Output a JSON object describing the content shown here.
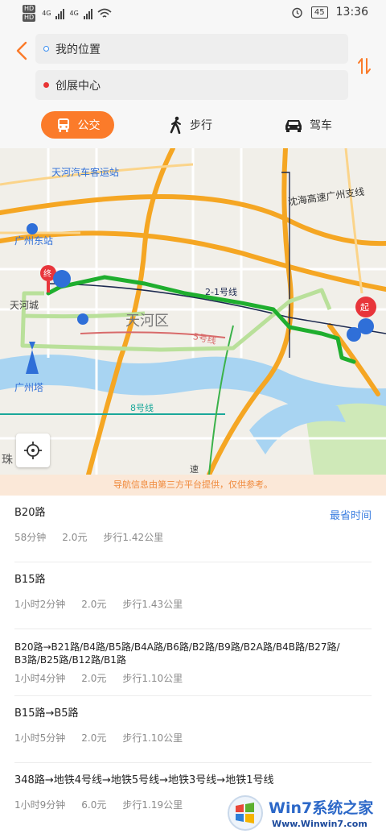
{
  "status_bar": {
    "hd1": "HD",
    "hd2": "HD",
    "net1": "4G",
    "net2": "4G",
    "battery": "45",
    "time": "13:36"
  },
  "header": {
    "origin": "我的位置",
    "destination": "创展中心",
    "modes": [
      {
        "label": "公交",
        "icon": "bus-icon",
        "active": true
      },
      {
        "label": "步行",
        "icon": "walk-icon",
        "active": false
      },
      {
        "label": "驾车",
        "icon": "car-icon",
        "active": false
      }
    ]
  },
  "map": {
    "labels": {
      "bus_station": "天河汽车客运站",
      "expressway": "沈海高速广州支线",
      "east_station": "广州东站",
      "line2_1": "2-1号线",
      "tianhe_district": "天河区",
      "tianhe_city": "天河城",
      "line5": "5号线",
      "canton_tower": "广州塔",
      "line8": "8号线",
      "pearl": "珠",
      "road": "速"
    },
    "start_marker": "起",
    "end_marker": "终"
  },
  "notice": "导航信息由第三方平台提供，仅供参考。",
  "routes": [
    {
      "title": "B20路",
      "duration": "58分钟",
      "price": "2.0元",
      "walk": "步行1.42公里",
      "badge": "最省时间"
    },
    {
      "title": "B15路",
      "duration": "1小时2分钟",
      "price": "2.0元",
      "walk": "步行1.43公里"
    },
    {
      "title_line1": "B20路→B21路/B4路/B5路/B4A路/B6路/B2路/B9路/B2A路/B4B路/B27路/",
      "title_line2": "B3路/B25路/B12路/B1路",
      "duration": "1小时4分钟",
      "price": "2.0元",
      "walk": "步行1.10公里"
    },
    {
      "title": "B15路→B5路",
      "duration": "1小时5分钟",
      "price": "2.0元",
      "walk": "步行1.10公里"
    },
    {
      "title": "348路→地铁4号线→地铁5号线→地铁3号线→地铁1号线",
      "duration": "1小时9分钟",
      "price": "6.0元",
      "walk": "步行1.19公里"
    }
  ],
  "watermark": {
    "text": "Win7系统之家",
    "url": "Www.Winwin7.com"
  },
  "colors": {
    "accent": "#fb7b2a",
    "route_green": "#1fae2e",
    "link_blue": "#3d7fe0"
  }
}
